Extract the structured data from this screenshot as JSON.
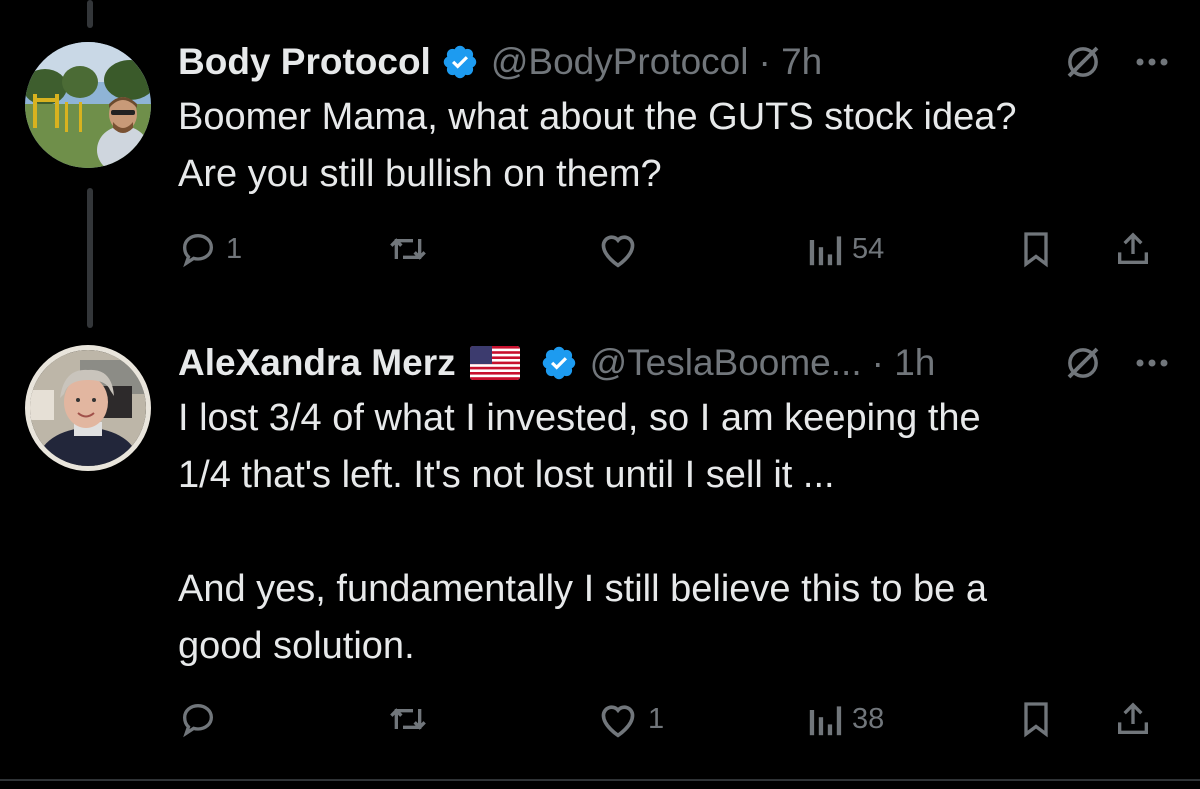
{
  "tweets": [
    {
      "name": "Body Protocol",
      "handle": "@BodyProtocol",
      "time": "· 7h",
      "text": "Boomer Mama, what about the GUTS stock idea?\nAre you still bullish on them?",
      "replies": "1",
      "retweets": "",
      "likes": "",
      "views": "54",
      "icons": [
        "verified-badge-icon",
        "grok-icon",
        "more-icon",
        "reply-icon",
        "retweet-icon",
        "like-icon",
        "views-icon",
        "bookmark-icon",
        "share-icon"
      ]
    },
    {
      "name": "AleXandra Merz",
      "handle": "@TeslaBoome...",
      "time": "· 1h",
      "text": "I lost 3/4 of what I invested, so I am keeping the\n1/4 that's left. It's not lost until I sell it ...\n\nAnd yes, fundamentally I still believe this to be a\ngood solution.",
      "replies": "",
      "retweets": "",
      "likes": "1",
      "views": "38",
      "icons": [
        "us-flag-icon",
        "verified-badge-icon",
        "grok-icon",
        "more-icon",
        "reply-icon",
        "retweet-icon",
        "like-icon",
        "views-icon",
        "bookmark-icon",
        "share-icon"
      ]
    }
  ],
  "colors": {
    "background": "#000000",
    "text": "#e7e9ea",
    "muted": "#71767b",
    "verified": "#1d9bf0"
  }
}
